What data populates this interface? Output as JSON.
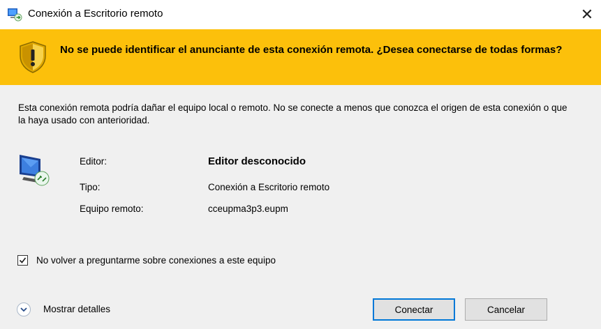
{
  "window": {
    "title": "Conexión a Escritorio remoto",
    "close_glyph": "✕"
  },
  "banner": {
    "text": "No se puede identificar el anunciante de esta conexión remota. ¿Desea conectarse de todas formas?",
    "icon": "shield-warning-icon",
    "color": "#fcc00b"
  },
  "warning": {
    "text": "Esta conexión remota podría dañar el equipo local o remoto. No se conecte a menos que conozca el origen de esta conexión o que la haya usado con anterioridad."
  },
  "details": {
    "icon": "remote-computer-icon",
    "rows": [
      {
        "label": "Editor:",
        "value": "Editor desconocido"
      },
      {
        "label": "Tipo:",
        "value": "Conexión a Escritorio remoto"
      },
      {
        "label": "Equipo remoto:",
        "value": "cceupma3p3.eupm"
      }
    ]
  },
  "checkbox": {
    "label": "No volver a preguntarme sobre conexiones a este equipo",
    "checked": true
  },
  "footer": {
    "details_label": "Mostrar detalles",
    "connect_label": "Conectar",
    "cancel_label": "Cancelar"
  }
}
